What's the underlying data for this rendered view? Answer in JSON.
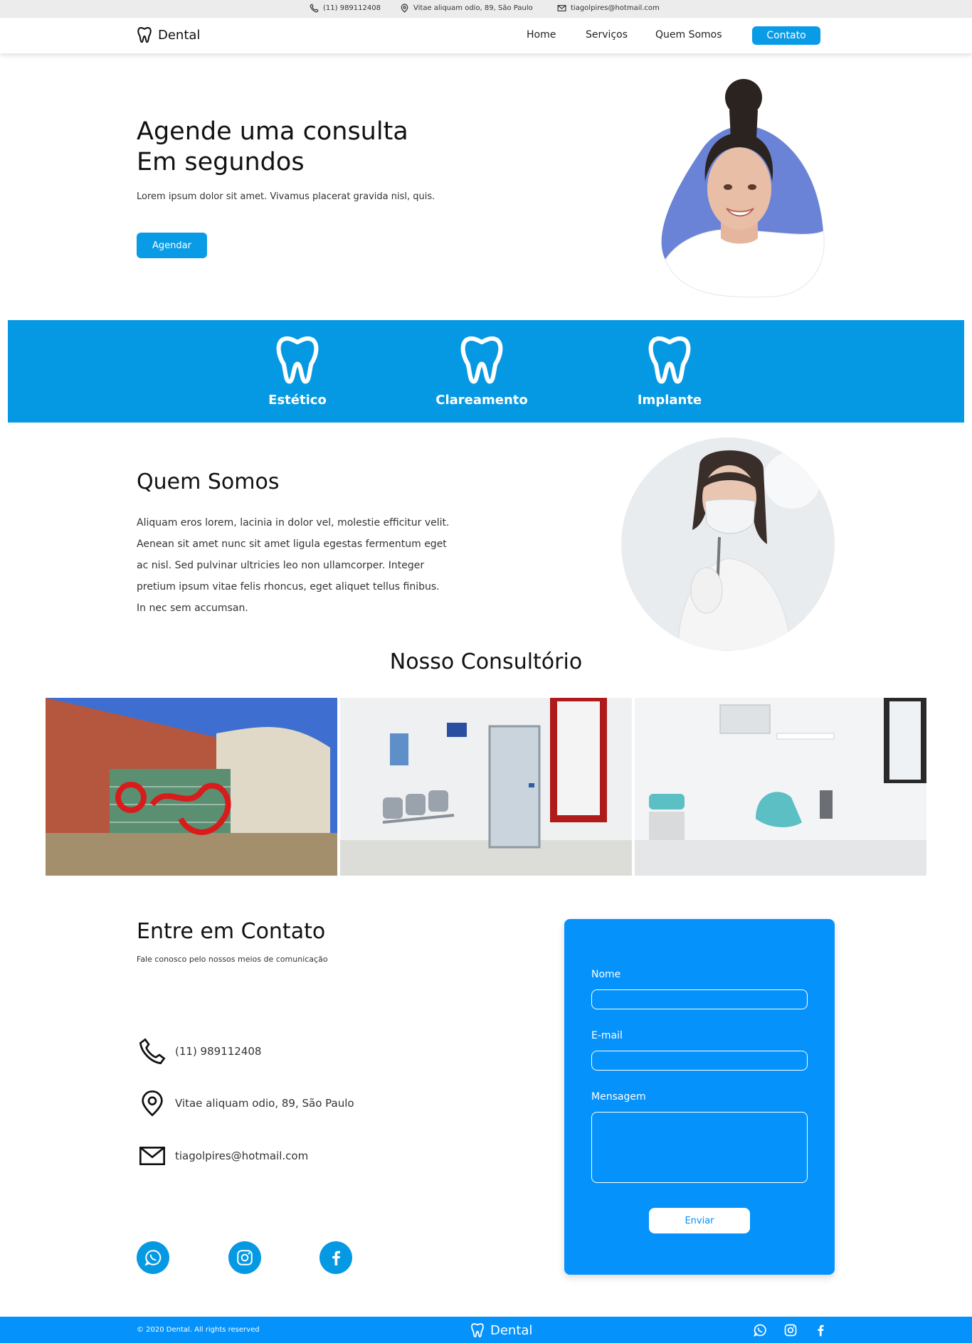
{
  "topbar": {
    "phone": "(11) 989112408",
    "address": "Vitae aliquam odio, 89, São Paulo",
    "email": "tiagolpires@hotmail.com"
  },
  "nav": {
    "brand": "Dental",
    "links": [
      "Home",
      "Serviços",
      "Quem Somos"
    ],
    "cta": "Contato"
  },
  "hero": {
    "title_line1": "Agende uma consulta",
    "title_line2": "Em segundos",
    "text": "Lorem ipsum dolor sit amet. Vivamus placerat gravida nisl, quis.",
    "button": "Agendar"
  },
  "services": [
    "Estético",
    "Clareamento",
    "Implante"
  ],
  "about": {
    "title": "Quem Somos",
    "text": "Aliquam eros lorem, lacinia in dolor vel, molestie efficitur velit. Aenean sit amet nunc sit amet ligula egestas fermentum eget ac nisl. Sed pulvinar ultricies leo non ullamcorper. Integer pretium ipsum vitae felis rhoncus, eget aliquet tellus finibus. In nec sem accumsan."
  },
  "office": {
    "title": "Nosso Consultório"
  },
  "contact": {
    "title": "Entre em Contato",
    "subtitle": "Fale conosco pelo nossos meios de comunicação",
    "phone": "(11) 989112408",
    "address": "Vitae aliquam odio, 89, São Paulo",
    "email": "tiagolpires@hotmail.com"
  },
  "form": {
    "name_label": "Nome",
    "email_label": "E-mail",
    "message_label": "Mensagem",
    "submit": "Enviar"
  },
  "footer": {
    "copyright": "© 2020 Dental. All rights reserved",
    "brand": "Dental"
  },
  "colors": {
    "primary": "#0599e3",
    "form_blue": "#0592fb",
    "hero_blob": "#6a83d6"
  },
  "icons": {
    "social": [
      "whatsapp-icon",
      "instagram-icon",
      "facebook-icon"
    ]
  }
}
